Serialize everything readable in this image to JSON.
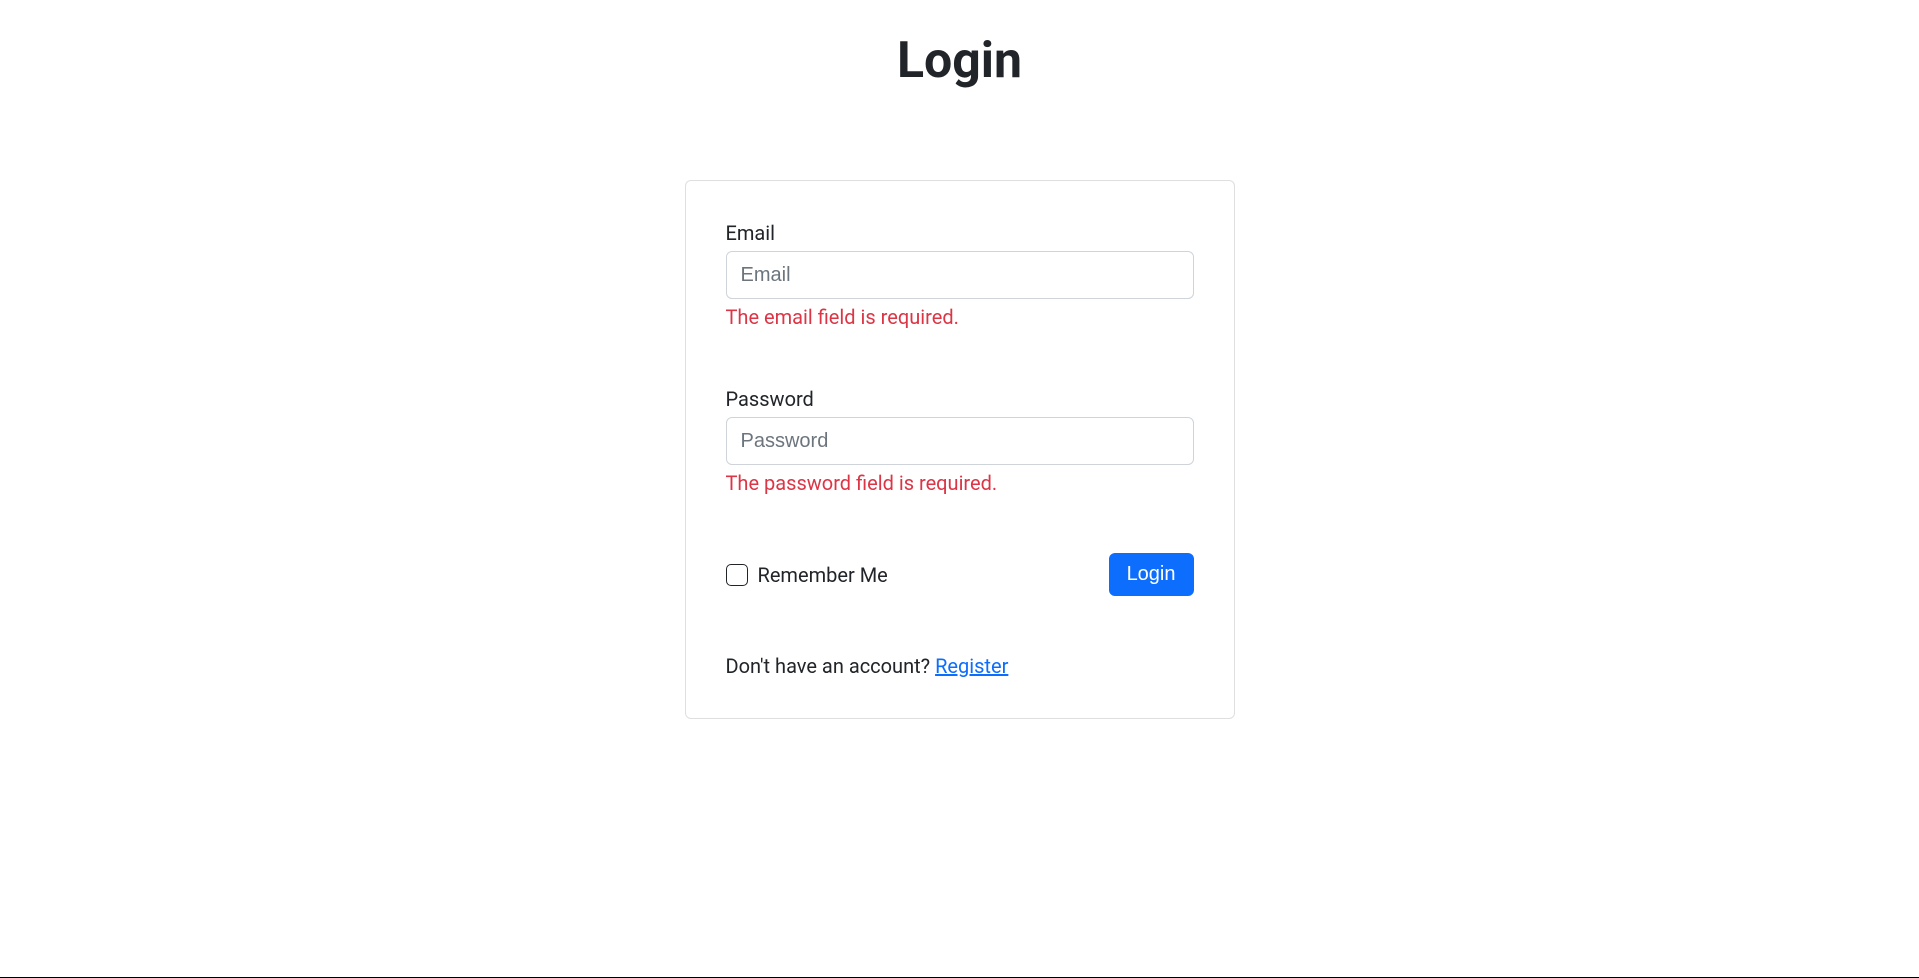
{
  "page": {
    "title": "Login"
  },
  "form": {
    "email": {
      "label": "Email",
      "placeholder": "Email",
      "value": "",
      "error": "The email field is required."
    },
    "password": {
      "label": "Password",
      "placeholder": "Password",
      "value": "",
      "error": "The password field is required."
    },
    "remember": {
      "label": "Remember Me",
      "checked": false
    },
    "submit": {
      "label": "Login"
    }
  },
  "footer": {
    "prompt": "Don't have an account? ",
    "register_link": "Register"
  },
  "colors": {
    "primary": "#0d6efd",
    "error": "#dc3545",
    "border": "#ced4da",
    "text": "#212529"
  }
}
